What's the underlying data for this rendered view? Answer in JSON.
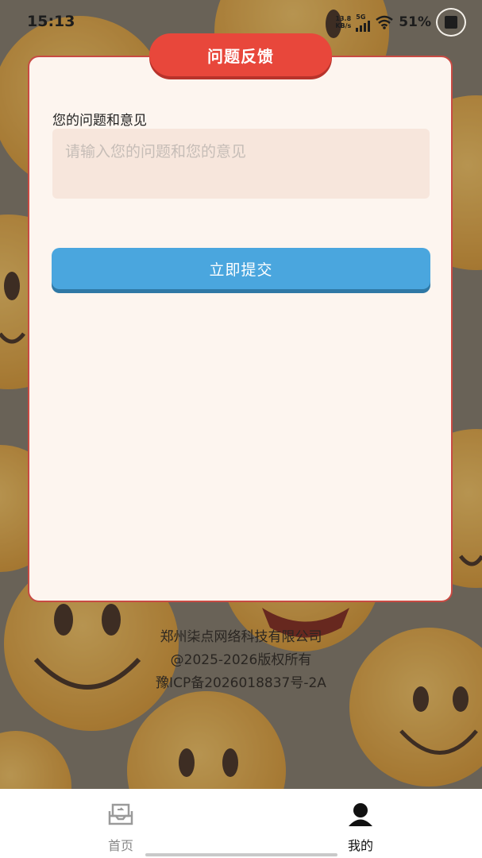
{
  "status_bar": {
    "time": "15:13",
    "speed_value": "13.8",
    "speed_unit": "KB/s",
    "network": "5G",
    "battery": "51%"
  },
  "card": {
    "title": "问题反馈",
    "field_label": "您的问题和意见",
    "field_placeholder": "请输入您的问题和您的意见",
    "field_value": "",
    "submit_label": "立即提交"
  },
  "footer": {
    "company": "郑州柒点网络科技有限公司",
    "copyright": "@2025-2026版权所有",
    "icp": "豫ICP备2026018837号-2A"
  },
  "tabbar": {
    "items": [
      {
        "label": "首页",
        "icon": "inbox-icon",
        "active": false
      },
      {
        "label": "我的",
        "icon": "user-icon",
        "active": true
      }
    ]
  },
  "colors": {
    "title_tab": "#e8473b",
    "submit": "#4aa6de",
    "card_bg": "#fdf5ef",
    "card_border": "#c84a43"
  }
}
